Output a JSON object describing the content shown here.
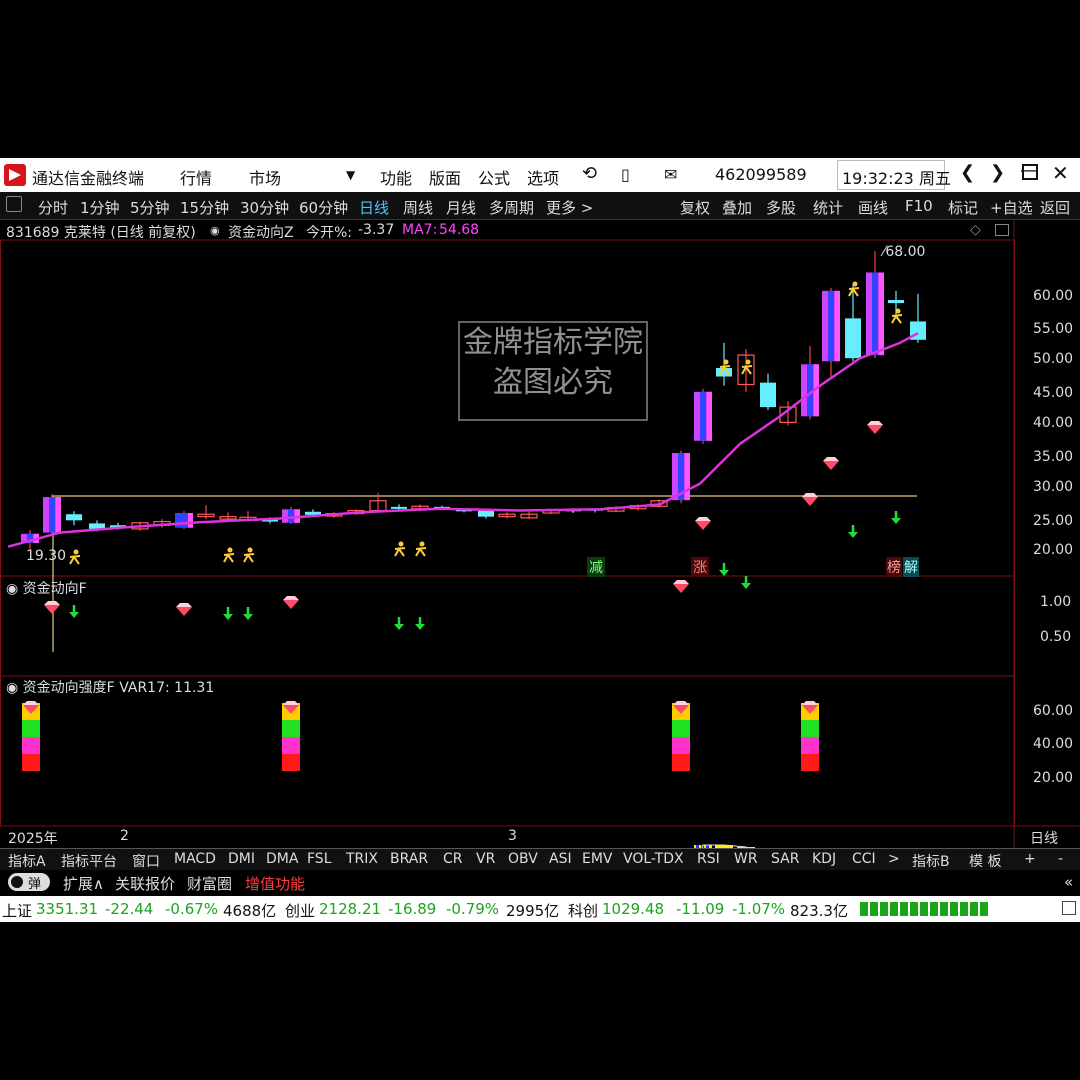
{
  "titlebar": {
    "app_name": "通达信金融终端",
    "menu": [
      "行情",
      "市场",
      "功能",
      "版面",
      "公式",
      "选项"
    ],
    "account": "462099589",
    "clock": "19:32:23 周五",
    "window_buttons": [
      "back-icon",
      "forward-icon",
      "minimize-icon",
      "maximize-icon",
      "close-icon"
    ]
  },
  "toolbar": {
    "periods": [
      "分时",
      "1分钟",
      "5分钟",
      "15分钟",
      "30分钟",
      "60分钟",
      "日线",
      "周线",
      "月线",
      "多周期",
      "更多 >"
    ],
    "active_period": "日线",
    "right_buttons": [
      "复权",
      "叠加",
      "多股",
      "统计",
      "画线",
      "F10",
      "标记",
      "+自选",
      "返回"
    ]
  },
  "info": {
    "stock": "831689 克莱特 (日线 前复权)",
    "indicator": "资金动向Z",
    "open_pct_label": "今开%:",
    "open_pct_value": "-3.37",
    "ma_label": "MA7:",
    "ma_value": "54.68",
    "high_label": "68.00",
    "low_label": "19.30"
  },
  "main_axis": [
    "60.00",
    "55.00",
    "50.00",
    "45.00",
    "40.00",
    "35.00",
    "30.00",
    "25.00",
    "20.00"
  ],
  "markers": {
    "jian": "减",
    "zhang": "涨",
    "bang": "榜",
    "jie": "解"
  },
  "watermark": {
    "line1": "金牌指标学院",
    "line2": "盗图必究"
  },
  "pane2": {
    "title": "资金动向F",
    "axis": [
      "1.00",
      "0.50"
    ]
  },
  "pane3": {
    "title": "资金动向强度F",
    "var_label": "VAR17:",
    "var_value": "11.31",
    "axis": [
      "60.00",
      "40.00",
      "20.00"
    ]
  },
  "date_axis": {
    "year": "2025年",
    "m2": "2",
    "m3": "3",
    "right_label": "日线"
  },
  "tabs": [
    "指标A",
    "指标平台",
    "窗口",
    "MACD",
    "DMI",
    "DMA",
    "FSL",
    "TRIX",
    "BRAR",
    "CR",
    "VR",
    "OBV",
    "ASI",
    "EMV",
    "VOL-TDX",
    "RSI",
    "WR",
    "SAR",
    "KDJ",
    "CCI",
    ">",
    "指标B",
    "模 板",
    "+",
    "-"
  ],
  "bar2": {
    "toggle": "弹",
    "items": [
      "扩展∧",
      "关联报价",
      "财富圈"
    ],
    "highlight": "增值功能",
    "right": "«"
  },
  "status": {
    "sh_label": "上证",
    "sh_val": "3351.31",
    "sh_chg": "-22.44",
    "sh_pct": "-0.67%",
    "sh_amt": "4688亿",
    "cy_label": "创业",
    "cy_val": "2128.21",
    "cy_chg": "-16.89",
    "cy_pct": "-0.79%",
    "cy_amt": "2995亿",
    "kc_label": "科创",
    "kc_val": "1029.48",
    "kc_chg": "-11.09",
    "kc_pct": "-1.07%",
    "kc_amt": "823.3亿"
  },
  "colors": {
    "up": "#ff3b3b",
    "down": "#4fe3ff",
    "ma": "#e040e0",
    "magenta": "#ff33ff",
    "blue": "#3355ff",
    "yellow": "#ffff00"
  }
}
